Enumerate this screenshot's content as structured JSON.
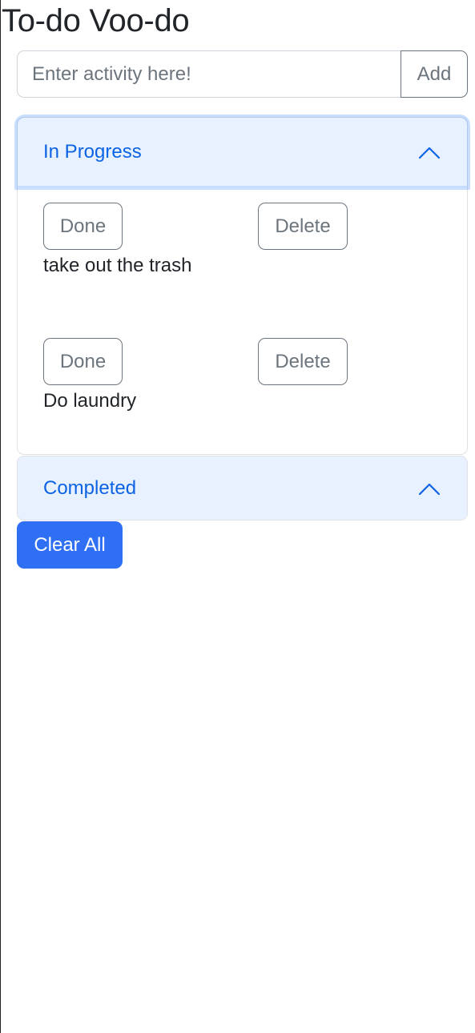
{
  "app": {
    "title": "To-do Voo-do"
  },
  "add_form": {
    "placeholder": "Enter activity here!",
    "value": "",
    "add_label": "Add"
  },
  "sections": {
    "in_progress": {
      "title": "In Progress",
      "expanded": true,
      "toggle_icon": "chevron-up-icon",
      "items": [
        {
          "text": "take out the trash",
          "done_label": "Done",
          "delete_label": "Delete"
        },
        {
          "text": "Do laundry",
          "done_label": "Done",
          "delete_label": "Delete"
        }
      ]
    },
    "completed": {
      "title": "Completed",
      "expanded": false,
      "toggle_icon": "chevron-up-icon",
      "items": []
    }
  },
  "actions": {
    "clear_all_label": "Clear All"
  },
  "colors": {
    "accent": "#2e6ff4",
    "accordion_header_bg": "#e7f1ff",
    "accordion_header_text": "#0c63e4",
    "outline_gray": "#6c757d"
  }
}
